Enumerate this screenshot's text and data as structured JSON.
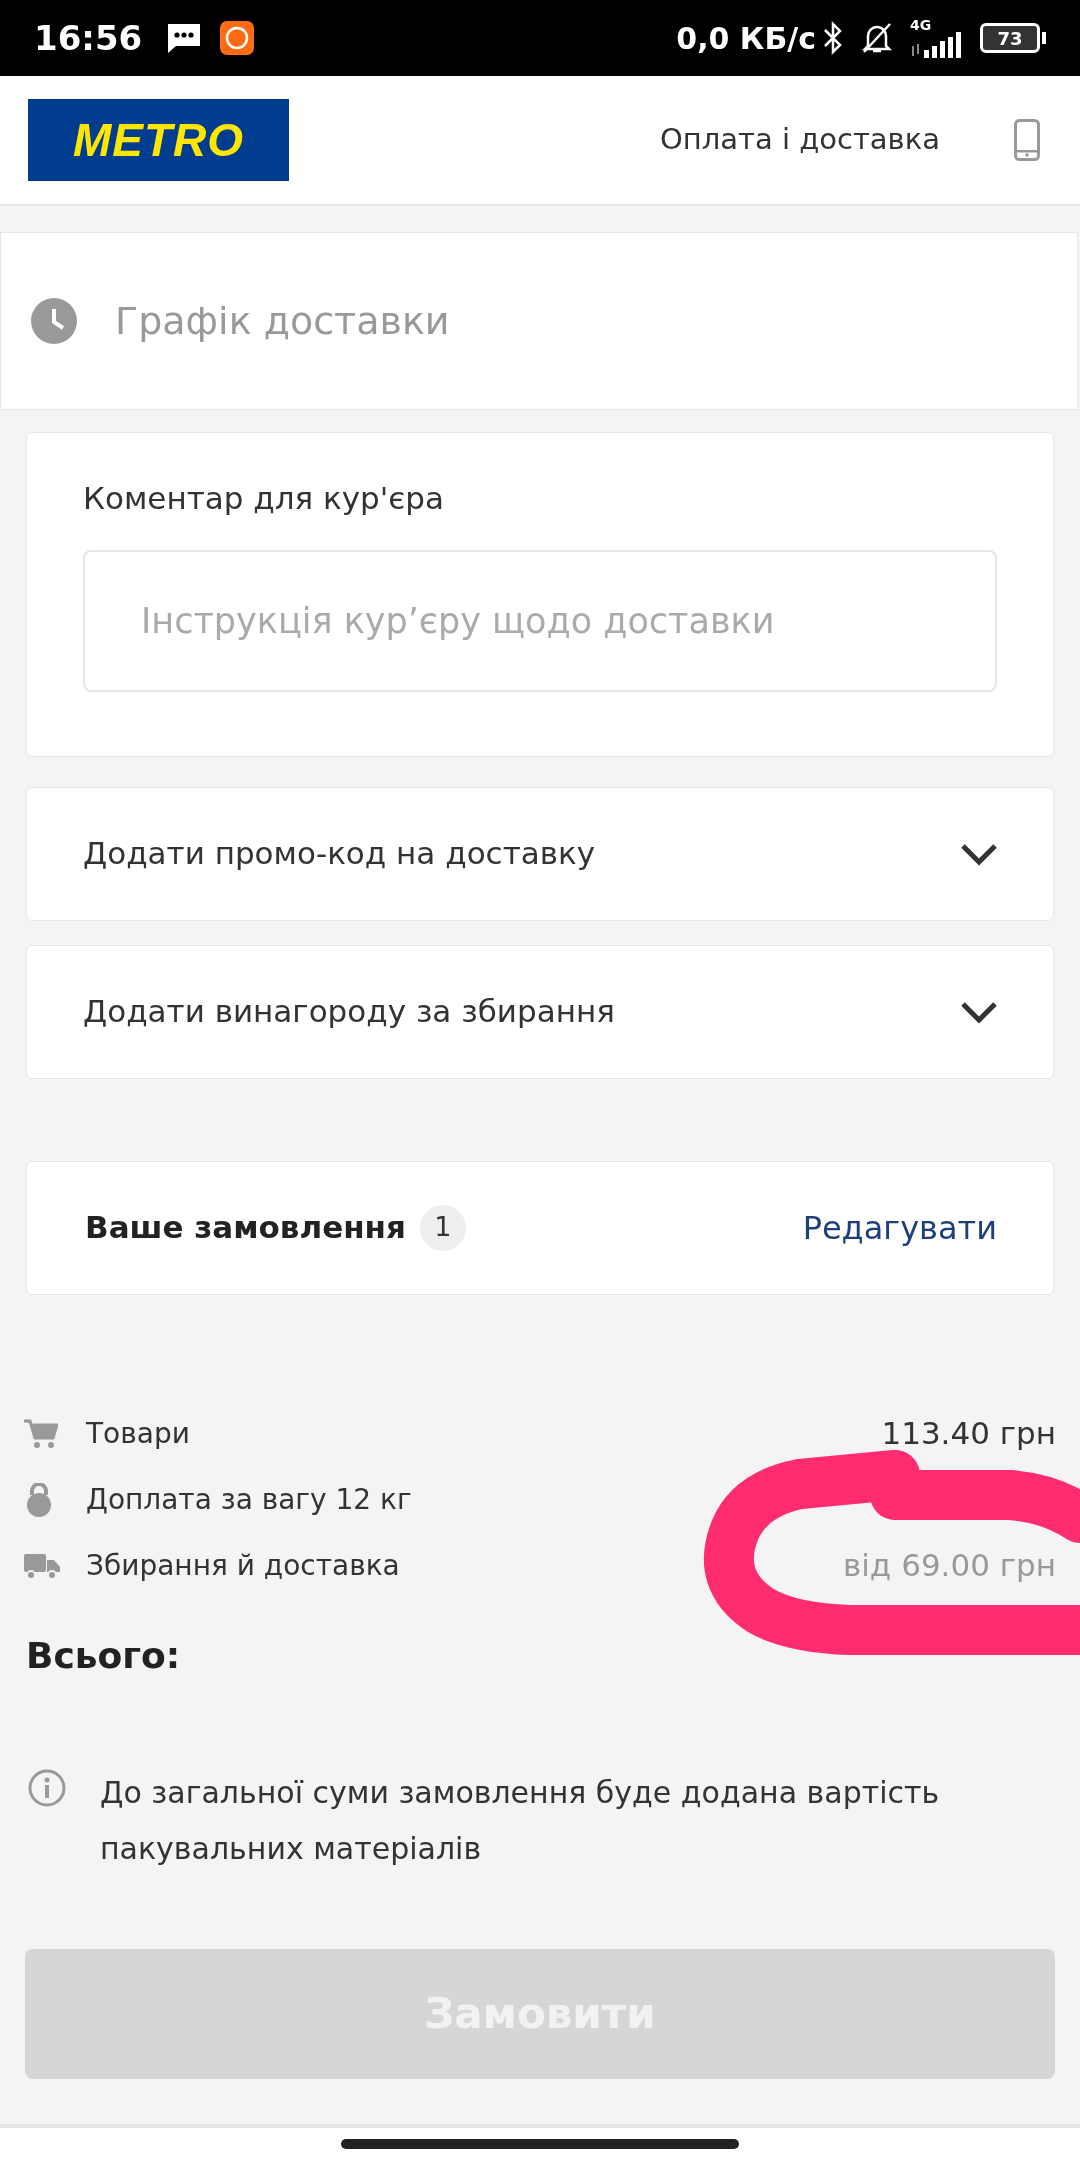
{
  "status_bar": {
    "time": "16:56",
    "speed": "0,0 КБ/с",
    "network": "4G",
    "battery": "73"
  },
  "header": {
    "logo": "METRO",
    "link": "Оплата і доставка"
  },
  "schedule": {
    "title": "Графік доставки"
  },
  "comment": {
    "label": "Коментар для кур'єра",
    "placeholder": "Інструкція кур’єру щодо доставки"
  },
  "accordions": [
    {
      "label": "Додати промо-код на доставку",
      "expanded": false
    },
    {
      "label": "Додати винагороду за збирання",
      "expanded": false
    }
  ],
  "order": {
    "title": "Ваше замовлення",
    "count": "1",
    "edit": "Редагувати"
  },
  "summary": [
    {
      "kind": "cart",
      "label": "Товари",
      "value": "113.40 грн",
      "muted": false
    },
    {
      "kind": "weight",
      "label": "Доплата за вагу 12 кг"
    },
    {
      "kind": "truck",
      "label": "Збирання й доставка",
      "value": "від 69.00 грн",
      "muted": true
    }
  ],
  "total": {
    "label": "Всього:"
  },
  "note": "До загальної суми замовлення буде додана вартість пакувальних матеріалів",
  "submit": {
    "label": "Замовити",
    "disabled": true
  }
}
